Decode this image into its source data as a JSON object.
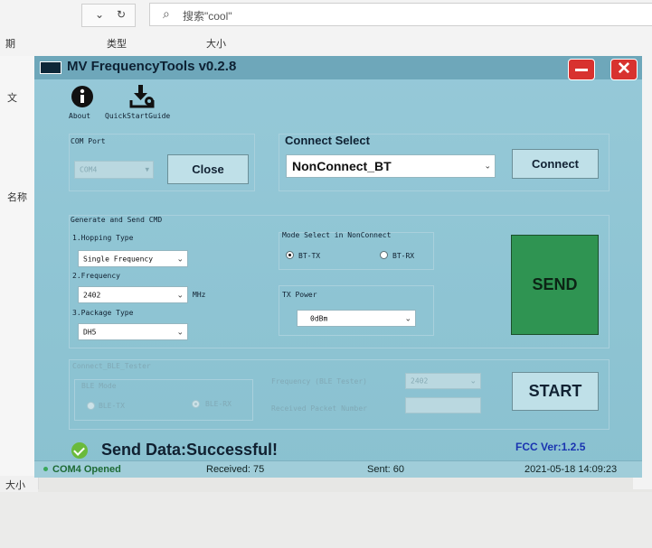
{
  "explorer": {
    "search_placeholder": "搜索\"cool\"",
    "col_date": "期",
    "col_type": "类型",
    "col_size": "大小",
    "left_labels": [
      "文",
      "名称"
    ],
    "size_label": "大小"
  },
  "window": {
    "title": "MV FrequencyTools v0.2.8",
    "minimize": "—",
    "close": "✕"
  },
  "toolbar": {
    "about": {
      "label": "About",
      "icon": "info-icon"
    },
    "guide": {
      "label": "QuickStartGuide",
      "icon": "download-gear-icon"
    }
  },
  "com_port": {
    "title": "COM Port",
    "value": "COM4",
    "close_button": "Close"
  },
  "connect_select": {
    "title": "Connect Select",
    "value": "NonConnect_BT",
    "connect_button": "Connect"
  },
  "generate": {
    "title": "Generate and Send CMD",
    "hopping_label": "1.Hopping Type",
    "hopping_value": "Single Frequency",
    "frequency_label": "2.Frequency",
    "frequency_value": "2402",
    "frequency_unit": "MHz",
    "package_label": "3.Package Type",
    "package_value": "DH5",
    "mode_title": "Mode Select in NonConnect",
    "mode_tx": "BT-TX",
    "mode_rx": "BT-RX",
    "mode_selected": "BT-TX",
    "tx_power_label": "TX Power",
    "tx_power_value": "0dBm",
    "send_button": "SEND"
  },
  "ble": {
    "title": "Connect_BLE_Tester",
    "mode_title": "BLE Mode",
    "mode_tx": "BLE-TX",
    "mode_rx": "BLE-RX",
    "mode_selected": "BLE-RX",
    "freq_label": "Frequency (BLE Tester)",
    "freq_value": "2402",
    "packet_label": "Received Packet Number",
    "packet_value": "",
    "start_button": "START"
  },
  "status": {
    "message": "Send Data:Successful!",
    "fcc": "FCC Ver:1.2.5",
    "com_state": "COM4 Opened",
    "received": "Received: 75",
    "sent": "Sent: 60",
    "timestamp": "2021-05-18 14:09:23"
  },
  "colors": {
    "send_button": "#2f9452",
    "success_icon": "#6aba3c",
    "window_controls": "#d8322f",
    "fcc_text": "#1a34b0"
  }
}
